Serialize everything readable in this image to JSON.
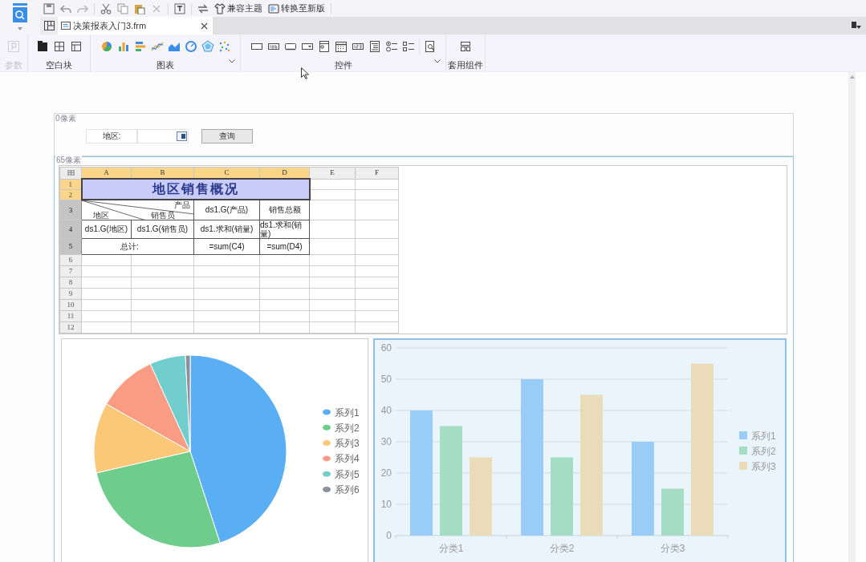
{
  "toolbar": {
    "buttons": [
      {
        "label": "兼容主题",
        "kind": "theme"
      },
      {
        "label": "转换至新版",
        "kind": "convert"
      }
    ]
  },
  "tabs": [
    {
      "label": "决策报表入门3.frm",
      "selected": true
    }
  ],
  "ribbon": {
    "groups": [
      {
        "label": "参数",
        "kind": "parameter",
        "disabled": true,
        "expandable": false
      },
      {
        "label": "空白块",
        "kind": "blank_block",
        "disabled": false,
        "expandable": false
      },
      {
        "label": "图表",
        "kind": "chart",
        "disabled": false,
        "expandable": true
      },
      {
        "label": "控件",
        "kind": "control",
        "disabled": false,
        "expandable": true
      },
      {
        "label": "套用组件",
        "kind": "template",
        "disabled": false,
        "expandable": false
      }
    ]
  },
  "parameter_panel": {
    "height_label": "0像素",
    "field_label": "地区:",
    "button": "查询"
  },
  "body_panel": {
    "height_label": "65像素"
  },
  "report": {
    "columns": [
      {
        "label": "A",
        "selected": true
      },
      {
        "label": "B",
        "selected": true
      },
      {
        "label": "C",
        "selected": true
      },
      {
        "label": "D",
        "selected": true
      },
      {
        "label": "E",
        "selected": false
      },
      {
        "label": "F",
        "selected": false
      }
    ],
    "rows": [
      {
        "label": "1",
        "selected": true,
        "occupied": false
      },
      {
        "label": "2",
        "selected": true,
        "occupied": false
      },
      {
        "label": "3",
        "selected": false,
        "occupied": true
      },
      {
        "label": "4",
        "selected": false,
        "occupied": true
      },
      {
        "label": "5",
        "selected": false,
        "occupied": true
      },
      {
        "label": "6",
        "selected": false,
        "occupied": false
      },
      {
        "label": "7",
        "selected": false,
        "occupied": false
      },
      {
        "label": "8",
        "selected": false,
        "occupied": false
      },
      {
        "label": "9",
        "selected": false,
        "occupied": false
      },
      {
        "label": "10",
        "selected": false,
        "occupied": false
      },
      {
        "label": "11",
        "selected": false,
        "occupied": false
      },
      {
        "label": "12",
        "selected": false,
        "occupied": false
      }
    ],
    "title": "地区销售概况",
    "slash_header": {
      "top": "产品",
      "middle": "销售员",
      "bottom": "地区"
    },
    "cells": {
      "c3": "ds1.G(产品)",
      "d3": "销售总额",
      "a4": "ds1.G(地区)",
      "b4": "ds1.G(销售员)",
      "c4": "ds1.求和(销量)",
      "d4": "ds1.求和(销量)",
      "a5": "总计:",
      "c5": "=sum(C4)",
      "d5": "=sum(D4)"
    }
  },
  "pie_chart": {
    "legend": [
      {
        "label": "系列1",
        "color": "#5aaef3"
      },
      {
        "label": "系列2",
        "color": "#6ecd8c"
      },
      {
        "label": "系列3",
        "color": "#fbc878"
      },
      {
        "label": "系列4",
        "color": "#fa9c84"
      },
      {
        "label": "系列5",
        "color": "#72cdcd"
      },
      {
        "label": "系列6",
        "color": "#8c8f9c"
      }
    ]
  },
  "bar_chart": {
    "chart_data": {
      "type": "bar",
      "categories": [
        "分类1",
        "分类2",
        "分类3"
      ],
      "series": [
        {
          "name": "系列1",
          "color": "#99ccf7",
          "values": [
            40,
            50,
            30
          ]
        },
        {
          "name": "系列2",
          "color": "#a4dcc4",
          "values": [
            35,
            25,
            15
          ]
        },
        {
          "name": "系列3",
          "color": "#eadcb8",
          "values": [
            25,
            45,
            55
          ]
        }
      ],
      "ylim": [
        0,
        60
      ],
      "yticks": [
        0,
        10,
        20,
        30,
        40,
        50,
        60
      ],
      "grid": true,
      "legend": true
    }
  }
}
